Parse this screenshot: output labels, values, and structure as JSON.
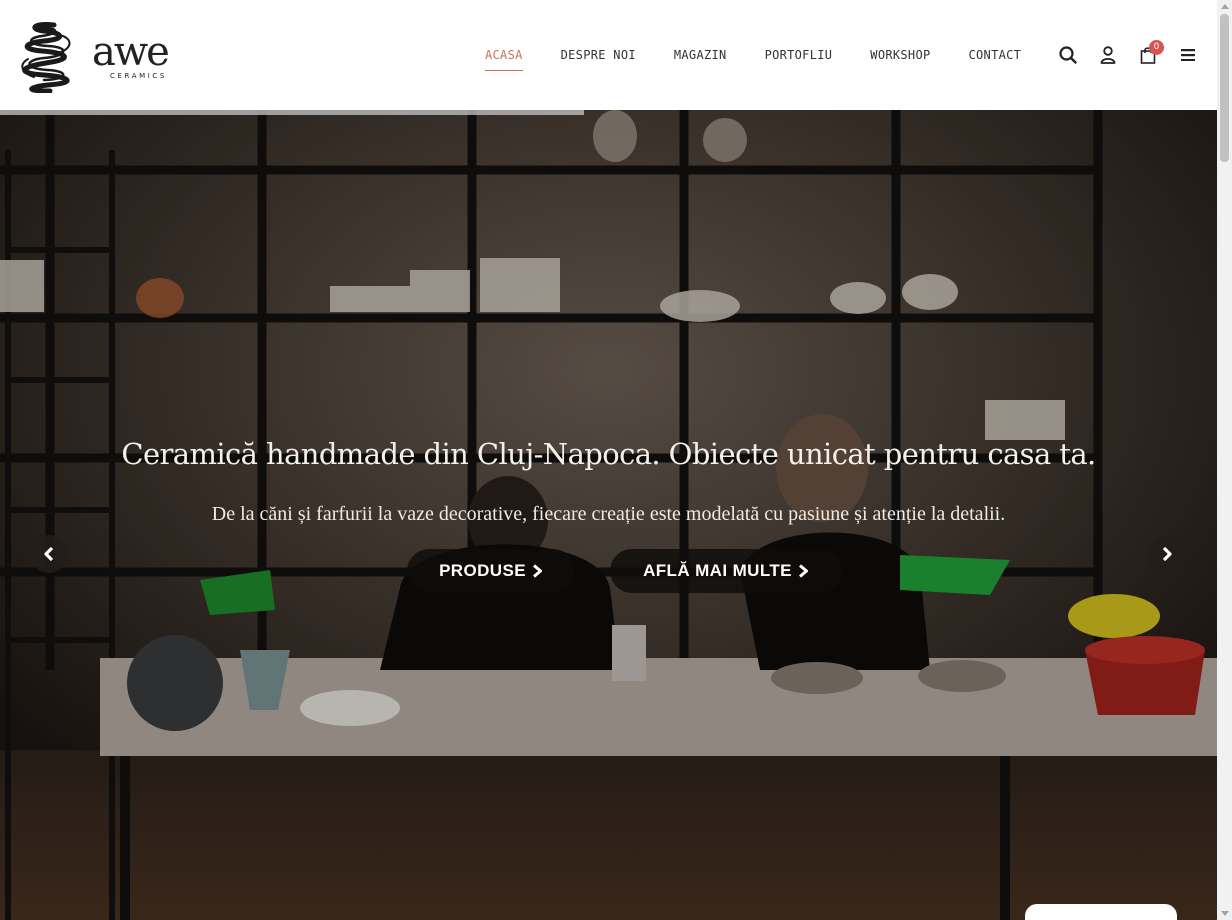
{
  "brand": {
    "name": "awe",
    "tagline": "CERAMICS"
  },
  "nav": {
    "items": [
      {
        "label": "ACASA",
        "active": true
      },
      {
        "label": "DESPRE NOI",
        "active": false
      },
      {
        "label": "MAGAZIN",
        "active": false
      },
      {
        "label": "PORTOFLIU",
        "active": false
      },
      {
        "label": "WORKSHOP",
        "active": false
      },
      {
        "label": "CONTACT",
        "active": false
      }
    ]
  },
  "header_icons": {
    "search": "search-icon",
    "account": "user-icon",
    "cart": "shopping-bag-icon",
    "cart_count": "0",
    "menu": "hamburger-menu-icon"
  },
  "hero": {
    "title": "Ceramică handmade din Cluj-Napoca. Obiecte unicat pentru casa ta.",
    "subtitle": "De la căni și farfurii la vaze decorative, fiecare creație este modelată cu pasiune și atenție la detalii.",
    "primary_button": "PRODUSE",
    "secondary_button": "AFLĂ MAI MULTE",
    "slider_progress": 0.48
  },
  "colors": {
    "accent": "#c8735a",
    "badge": "#d9534f",
    "button_bg": "#0f0c0a"
  }
}
